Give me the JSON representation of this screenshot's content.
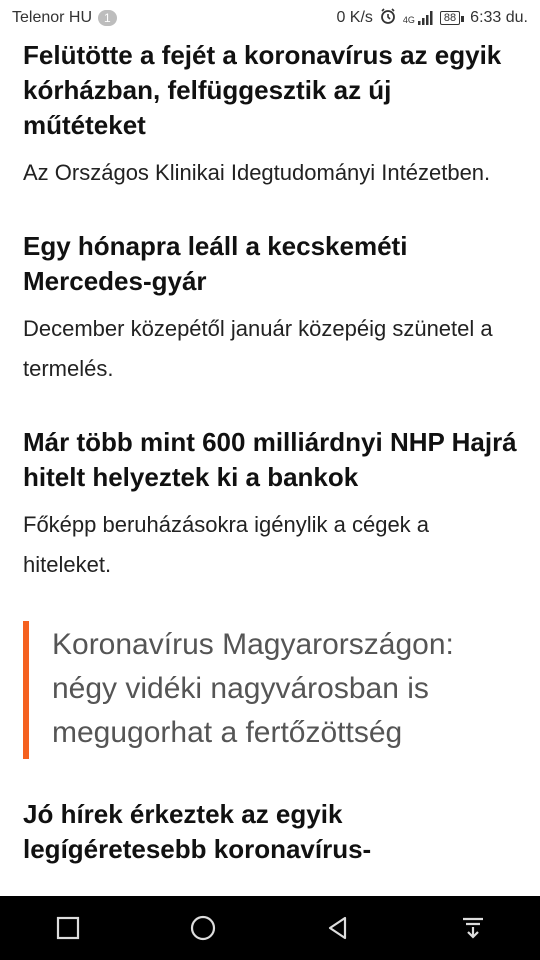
{
  "status_bar": {
    "carrier": "Telenor HU",
    "notification_count": "1",
    "speed": "0 K/s",
    "network": "4G",
    "battery": "88",
    "time": "6:33 du."
  },
  "articles": [
    {
      "title": "Felütötte a fejét a koronavírus az egyik kórházban, felfüggesztik az új műtéteket",
      "lead": "Az Országos Klinikai Idegtudományi Intézetben."
    },
    {
      "title": "Egy hónapra leáll a kecskeméti Mercedes-gyár",
      "lead": "December közepétől január közepéig szünetel a termelés."
    },
    {
      "title": "Már több mint 600 milliárdnyi NHP Hajrá hitelt helyeztek ki a bankok",
      "lead": "Főképp beruházásokra igénylik a cégek a hiteleket."
    }
  ],
  "quote": {
    "text": "Koronavírus Magyarországon: négy vidéki nagyvárosban is megugorhat a fertőzöttség"
  },
  "partial_article": {
    "title": "Jó hírek érkeztek az egyik legígéretesebb koronavírus-"
  },
  "colors": {
    "accent": "#f5611f",
    "nav_bar": "#000000"
  },
  "nav_icons": [
    "square-icon",
    "circle-icon",
    "back-triangle-icon",
    "notification-pull-icon"
  ]
}
